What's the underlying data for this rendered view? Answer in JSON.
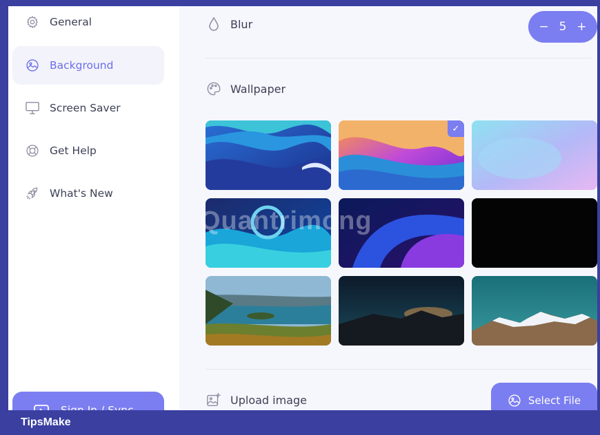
{
  "sidebar": {
    "items": [
      {
        "label": "General",
        "icon": "gear-icon"
      },
      {
        "label": "Background",
        "icon": "image-icon"
      },
      {
        "label": "Screen Saver",
        "icon": "monitor-icon"
      },
      {
        "label": "Get Help",
        "icon": "lifebuoy-icon"
      },
      {
        "label": "What's New",
        "icon": "rocket-icon"
      }
    ],
    "active": "Background",
    "signin_label": "Sign In / Sync"
  },
  "main": {
    "blur_label": "Blur",
    "blur_value": "5",
    "stepper_minus": "−",
    "stepper_plus": "+",
    "wallpaper_label": "Wallpaper",
    "upload_label": "Upload image",
    "select_file_label": "Select File",
    "selected_wallpaper_index": 1,
    "check_mark": "✓"
  },
  "watermark": "Quantrimong",
  "banner": {
    "text": "TipsMake"
  },
  "colors": {
    "accent": "#7b7ef0",
    "frame": "#3a3fa0",
    "main_bg": "#f6f7fc",
    "active_item_bg": "#f2f3fb"
  }
}
